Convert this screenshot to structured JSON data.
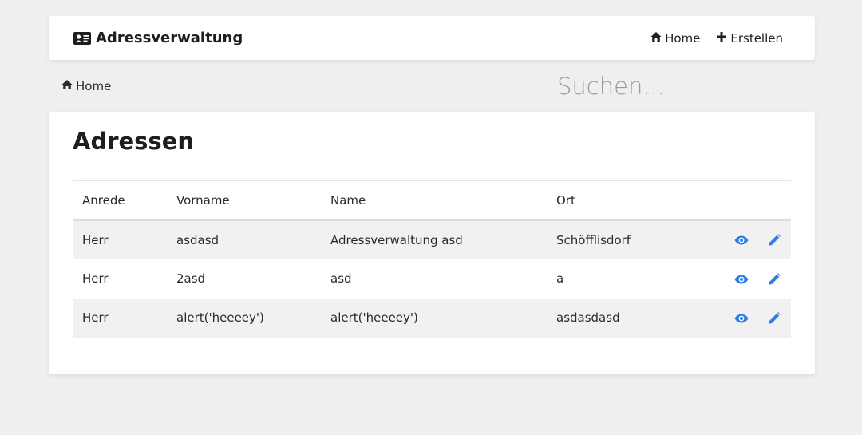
{
  "navbar": {
    "brand": "Adressverwaltung",
    "links": [
      {
        "label": "Home",
        "icon": "home-icon"
      },
      {
        "label": "Erstellen",
        "icon": "plus-icon"
      }
    ]
  },
  "breadcrumb": {
    "label": "Home",
    "icon": "home-icon"
  },
  "search": {
    "placeholder": "Suchen..."
  },
  "main": {
    "title": "Adressen",
    "table": {
      "headers": [
        "Anrede",
        "Vorname",
        "Name",
        "Ort"
      ],
      "rows": [
        {
          "anrede": "Herr",
          "vorname": "asdasd",
          "name": "Adressverwaltung asd",
          "ort": "Schöfflisdorf"
        },
        {
          "anrede": "Herr",
          "vorname": "2asd",
          "name": "asd",
          "ort": "a"
        },
        {
          "anrede": "Herr",
          "vorname": "alert('heeeey')",
          "name": "alert('heeeey')",
          "ort": "asdasdasd"
        }
      ]
    }
  },
  "colors": {
    "accent": "#2f7ee8",
    "background": "#efefef",
    "stripe": "#f1f1f1"
  }
}
